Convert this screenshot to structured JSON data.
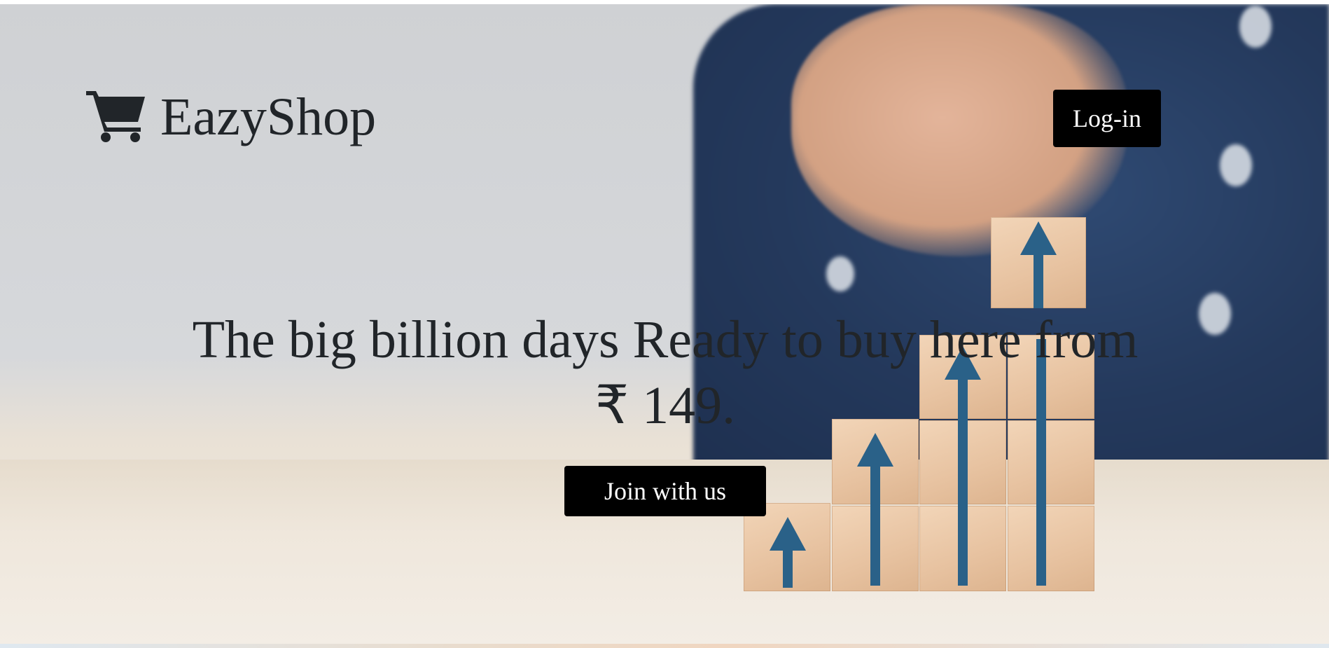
{
  "header": {
    "brand_icon": "shopping-cart-icon",
    "brand_name": "EazyShop",
    "login_label": "Log-in"
  },
  "hero": {
    "headline_line1": "The big billion days Ready to buy here from",
    "headline_line2": "₹ 149.",
    "cta_label": "Join with us"
  },
  "colors": {
    "text": "#212529",
    "button_bg": "#000000",
    "button_text": "#ffffff",
    "arrow": "#2a6188"
  }
}
